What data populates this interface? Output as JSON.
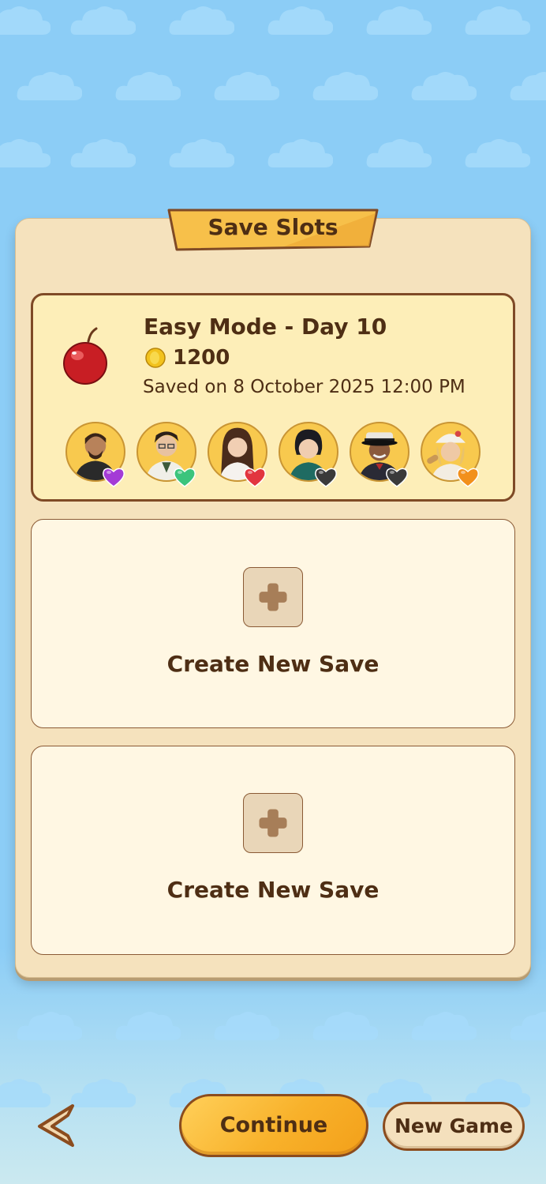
{
  "panel": {
    "title": "Save Slots"
  },
  "save_slot": {
    "title": "Easy Mode - Day 10",
    "coins": "1200",
    "saved_on": "Saved on 8 October 2025 12:00 PM",
    "characters": [
      {
        "icon": "bearded-man-avatar",
        "heart_color": "#a43bd6"
      },
      {
        "icon": "glasses-man-avatar",
        "heart_color": "#3bc47c"
      },
      {
        "icon": "long-hair-woman-avatar",
        "heart_color": "#e2353f"
      },
      {
        "icon": "short-hair-woman-avatar",
        "heart_color": "#3a3a3a"
      },
      {
        "icon": "old-man-hat-avatar",
        "heart_color": "#3a3a3a"
      },
      {
        "icon": "chef-woman-avatar",
        "heart_color": "#f2901c"
      }
    ]
  },
  "empty_slots": [
    {
      "label": "Create New Save"
    },
    {
      "label": "Create New Save"
    }
  ],
  "bottom_bar": {
    "continue_label": "Continue",
    "new_game_label": "New Game"
  },
  "colors": {
    "panel_bg": "#f5e2bd",
    "text_brown": "#4e2e14",
    "accent_gold": "#f8b12a",
    "sky_blue": "#8ccdf6"
  }
}
